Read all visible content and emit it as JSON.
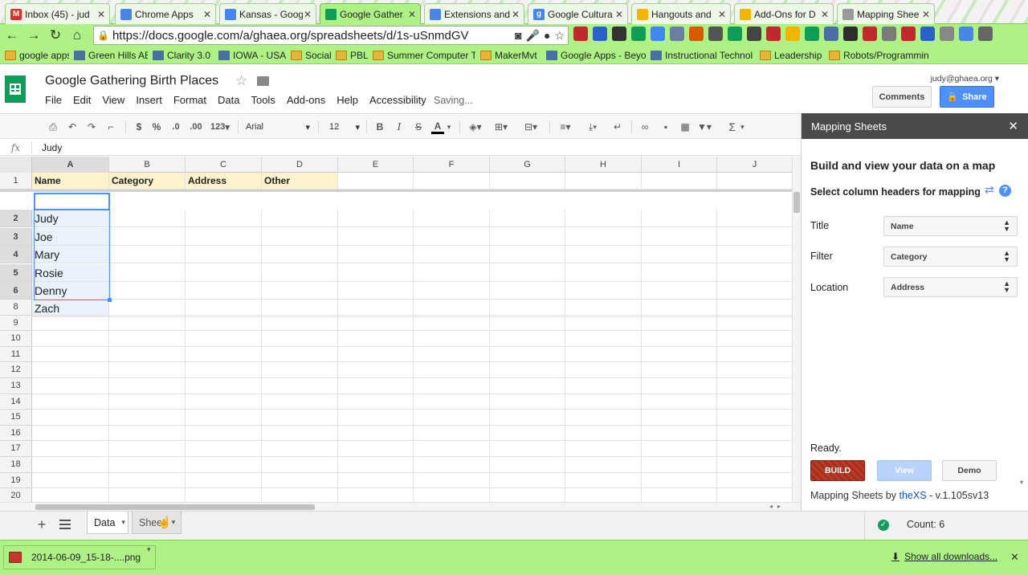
{
  "browser": {
    "tabs": [
      {
        "title": "Inbox (45) - jud",
        "icon": "gmail-icon",
        "color": "#d93025",
        "glyph": "M"
      },
      {
        "title": "Chrome Apps",
        "icon": "webstore-icon",
        "color": "#4a86e8",
        "glyph": ""
      },
      {
        "title": "Kansas - Goog",
        "icon": "docs-icon",
        "color": "#4285f4",
        "glyph": ""
      },
      {
        "title": "Google Gather",
        "icon": "sheets-icon",
        "color": "#0f9d58",
        "glyph": ""
      },
      {
        "title": "Extensions and",
        "icon": "extensions-icon",
        "color": "#4a86e8",
        "glyph": ""
      },
      {
        "title": "Google Cultura",
        "icon": "google-icon",
        "color": "#4285f4",
        "glyph": "g"
      },
      {
        "title": "Hangouts and",
        "icon": "slides-icon",
        "color": "#f4b400",
        "glyph": ""
      },
      {
        "title": "Add-Ons for D",
        "icon": "slides-icon",
        "color": "#f4b400",
        "glyph": ""
      },
      {
        "title": "Mapping Shee",
        "icon": "drive-icon",
        "color": "#999999",
        "glyph": ""
      }
    ],
    "active_tab": 3,
    "url": "https://docs.google.com/a/ghaea.org/spreadsheets/d/1s-uSnmdGV",
    "bookmarks": [
      {
        "label": "google apps",
        "kind": "folder"
      },
      {
        "label": "Green Hills AEA",
        "kind": "site"
      },
      {
        "label": "Clarity 3.0",
        "kind": "site"
      },
      {
        "label": "IOWA - USA",
        "kind": "site"
      },
      {
        "label": "Social",
        "kind": "folder"
      },
      {
        "label": "PBL",
        "kind": "folder"
      },
      {
        "label": "Summer Computer T",
        "kind": "folder"
      },
      {
        "label": "MakerMvt",
        "kind": "folder"
      },
      {
        "label": "Google Apps - Beyon",
        "kind": "site"
      },
      {
        "label": "Instructional Technol",
        "kind": "site"
      },
      {
        "label": "Leadership",
        "kind": "folder"
      },
      {
        "label": "Robots/Programmin",
        "kind": "folder"
      }
    ]
  },
  "doc": {
    "title": "Google Gathering Birth Places",
    "menu": [
      "File",
      "Edit",
      "View",
      "Insert",
      "Format",
      "Data",
      "Tools",
      "Add-ons",
      "Help",
      "Accessibility"
    ],
    "saving": "Saving...",
    "user": "judy@ghaea.org",
    "comments_label": "Comments",
    "share_label": "Share"
  },
  "toolbar": {
    "currency": "$",
    "percent": "%",
    "dec_less": ".0",
    "dec_more": ".00",
    "number_format": "123",
    "font": "Arial",
    "font_size": "12",
    "bold": "B",
    "italic": "I",
    "strike": "S",
    "text_color": "A",
    "sum": "Σ"
  },
  "formula_bar": {
    "label": "fx",
    "value": "Judy"
  },
  "grid": {
    "columns": [
      "A",
      "B",
      "C",
      "D",
      "E",
      "F",
      "G",
      "H",
      "I",
      "J"
    ],
    "selected_column": "A",
    "row_numbers": [
      "1",
      "2",
      "3",
      "4",
      "5",
      "6",
      "7",
      "8",
      "9",
      "10",
      "11",
      "12",
      "13",
      "14",
      "15",
      "16",
      "17",
      "18",
      "19",
      "20"
    ],
    "selected_rows": [
      "2",
      "3",
      "4",
      "5",
      "6",
      "7"
    ],
    "header_row": [
      "Name",
      "Category",
      "Address",
      "Other"
    ],
    "names": [
      "Judy",
      "Joe",
      "Mary",
      "Rosie",
      "Denny",
      "Zach"
    ]
  },
  "sheets": {
    "tabs": [
      "Data",
      "Sheet"
    ],
    "active": "Data",
    "status_count": "Count: 6"
  },
  "panel": {
    "title": "Mapping Sheets",
    "heading": "Build and view your data on a map",
    "subheading": "Select column headers for mapping",
    "fields": [
      {
        "label": "Title",
        "value": "Name"
      },
      {
        "label": "Filter",
        "value": "Category"
      },
      {
        "label": "Location",
        "value": "Address"
      }
    ],
    "status": "Ready.",
    "build_label": "BUILD",
    "view_label": "View",
    "demo_label": "Demo",
    "credit_prefix": "Mapping Sheets by ",
    "credit_link": "theXS",
    "credit_suffix": " - v.1.105sv13"
  },
  "downloads": {
    "file": "2014-06-09_15-18-....png",
    "show_all": "Show all downloads..."
  },
  "colors": {
    "chrome_green": "#aef286",
    "sheets_green": "#0f9d58",
    "share_blue": "#4d90fe",
    "build_red": "#b2301c",
    "header_fill": "#fcf2cc"
  }
}
